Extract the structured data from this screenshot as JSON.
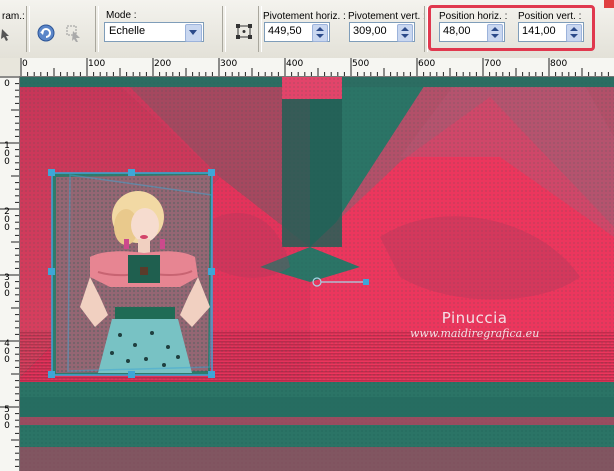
{
  "toolbar": {
    "preset_label": "ram.",
    "mode_label": "Mode :",
    "mode_value": "Echelle",
    "rot_h_label": "Pivotement horiz. :",
    "rot_h_value": "449,50",
    "rot_v_label": "Pivotement vert. :",
    "rot_v_value": "309,00",
    "pos_h_label": "Position horiz. :",
    "pos_h_value": "48,00",
    "pos_v_label": "Position vert. :",
    "pos_v_value": "141,00"
  },
  "ruler": {
    "horizontal": [
      "0",
      "100",
      "200",
      "300",
      "400",
      "500",
      "600",
      "700",
      "800"
    ],
    "vertical": [
      "0",
      "100",
      "200",
      "300",
      "400",
      "500"
    ]
  },
  "watermark": {
    "name": "Pinuccia",
    "url": "www.maidiregrafica.eu"
  },
  "colors": {
    "canvas_teal": "#2b7466",
    "canvas_pink": "#e8325a",
    "selection_handle": "#3ea6d6",
    "highlight": "#e0384e"
  }
}
